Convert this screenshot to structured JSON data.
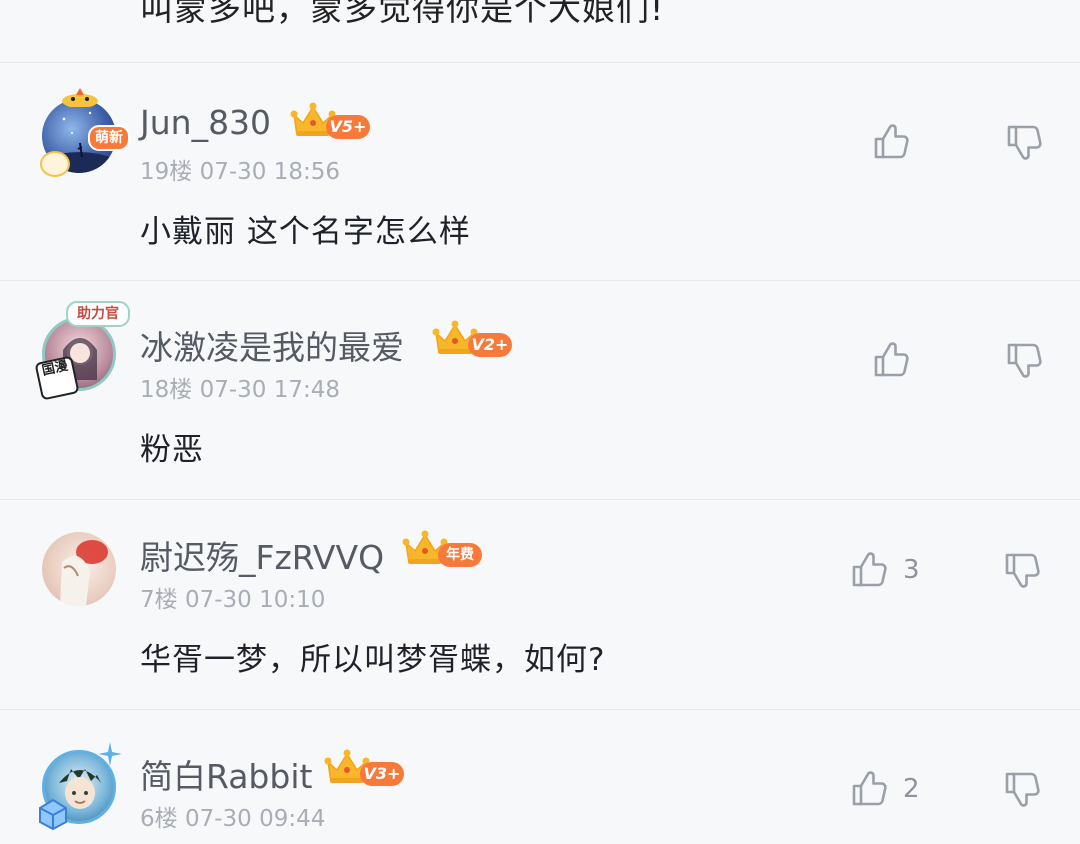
{
  "previous_comment": {
    "text": "叫蒙多吧，蒙多觉得你是个大娘们!"
  },
  "comments": [
    {
      "username": "Jun_830",
      "level_badge": "V5+",
      "avatar_badge": "萌新",
      "floor": "19楼",
      "time": "07-30 18:56",
      "text": "小戴丽 这个名字怎么样",
      "likes": "",
      "colors": {
        "badge": "#f77a3b",
        "crown": "#f8b62a"
      }
    },
    {
      "username": "冰激凌是我的最爱",
      "level_badge": "V2+",
      "avatar_badge_top": "助力官",
      "avatar_badge_side": "国漫",
      "floor": "18楼",
      "time": "07-30 17:48",
      "text": "粉恶",
      "likes": "",
      "colors": {
        "badge": "#f77a3b",
        "crown": "#f8b62a"
      }
    },
    {
      "username": "尉迟殇_FzRVVQ",
      "level_badge": "年费",
      "floor": "7楼",
      "time": "07-30 10:10",
      "text": "华胥一梦，所以叫梦胥蝶，如何?",
      "likes": "3",
      "colors": {
        "badge": "#f77a3b",
        "crown": "#f8b62a"
      }
    },
    {
      "username": "简白Rabbit",
      "level_badge": "V3+",
      "floor": "6楼",
      "time": "07-30 09:44",
      "text": "",
      "likes": "2",
      "colors": {
        "badge": "#f77a3b",
        "crown": "#f8b62a"
      }
    }
  ]
}
